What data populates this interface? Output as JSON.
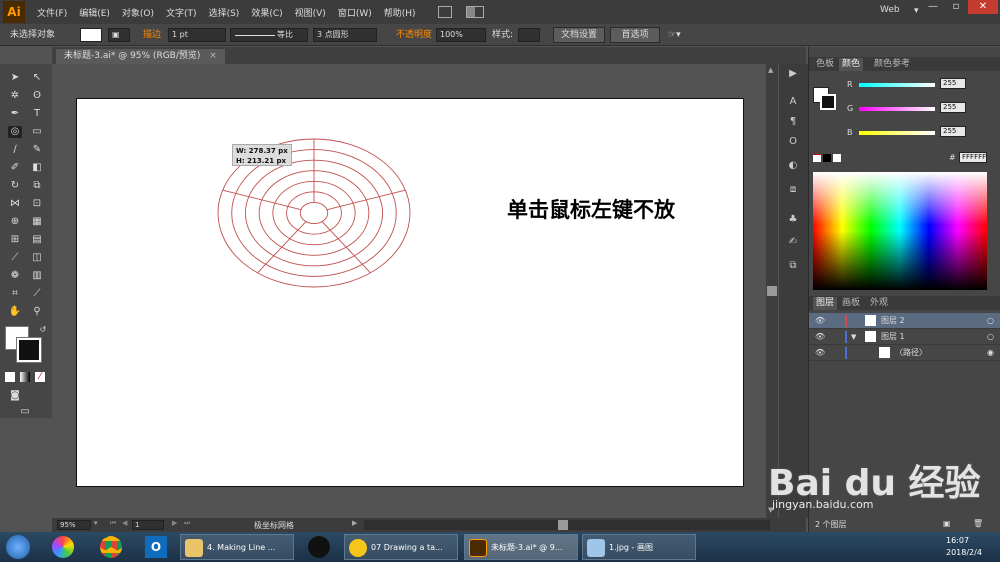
{
  "menubar": {
    "logo": "Ai",
    "items": [
      "文件(F)",
      "编辑(E)",
      "对象(O)",
      "文字(T)",
      "选择(S)",
      "效果(C)",
      "视图(V)",
      "窗口(W)",
      "帮助(H)"
    ],
    "workspace": "Web"
  },
  "control": {
    "selection": "未选择对象",
    "stroke_label": "描边",
    "stroke_weight": "1 pt",
    "stroke_profile": "等比",
    "brush": "3 点圆形",
    "opacity_label": "不透明度",
    "opacity_value": "100%",
    "style_label": "样式:",
    "doc_setup": "文档设置",
    "prefs": "首选项"
  },
  "document": {
    "tab_title": "未标题-3.ai* @ 95% (RGB/预览)",
    "close": "×"
  },
  "canvas": {
    "tooltip_w": "W: 278.37 px",
    "tooltip_h": "H: 213.21 px",
    "instruction": "单击鼠标左键不放",
    "grid": {
      "concentric_dividers": 6,
      "radial_dividers": 5
    }
  },
  "status": {
    "zoom": "95%",
    "page": "1",
    "tool_name": "极坐标网格"
  },
  "color_panel": {
    "tabs": [
      "色板",
      "颜色",
      "颜色参考"
    ],
    "r_label": "R",
    "g_label": "G",
    "b_label": "B",
    "r": "255",
    "g": "255",
    "b": "255",
    "hex": "FFFFFF",
    "hash": "#"
  },
  "layers_panel": {
    "tabs": [
      "图层",
      "画板",
      "外观"
    ],
    "layers": [
      {
        "name": "图层 2",
        "color": "#d94b4b"
      },
      {
        "name": "图层 1",
        "color": "#4b6fd9"
      },
      {
        "name": "〈路径〉",
        "color": "#4b6fd9"
      }
    ],
    "footer": "2 个图层"
  },
  "taskbar": {
    "items": [
      {
        "label": "4. Making Line ...",
        "icon": "folder-icon"
      },
      {
        "label": "07 Drawing a ta...",
        "icon": "media-icon"
      },
      {
        "label": "未标题-3.ai* @ 9...",
        "icon": "illustrator-icon"
      },
      {
        "label": "1.jpg - 画图",
        "icon": "paint-icon"
      }
    ],
    "time": "16:07",
    "date": "2018/2/4"
  },
  "watermark": {
    "logo": "Bai du 经验",
    "url": "jingyan.baidu.com"
  }
}
